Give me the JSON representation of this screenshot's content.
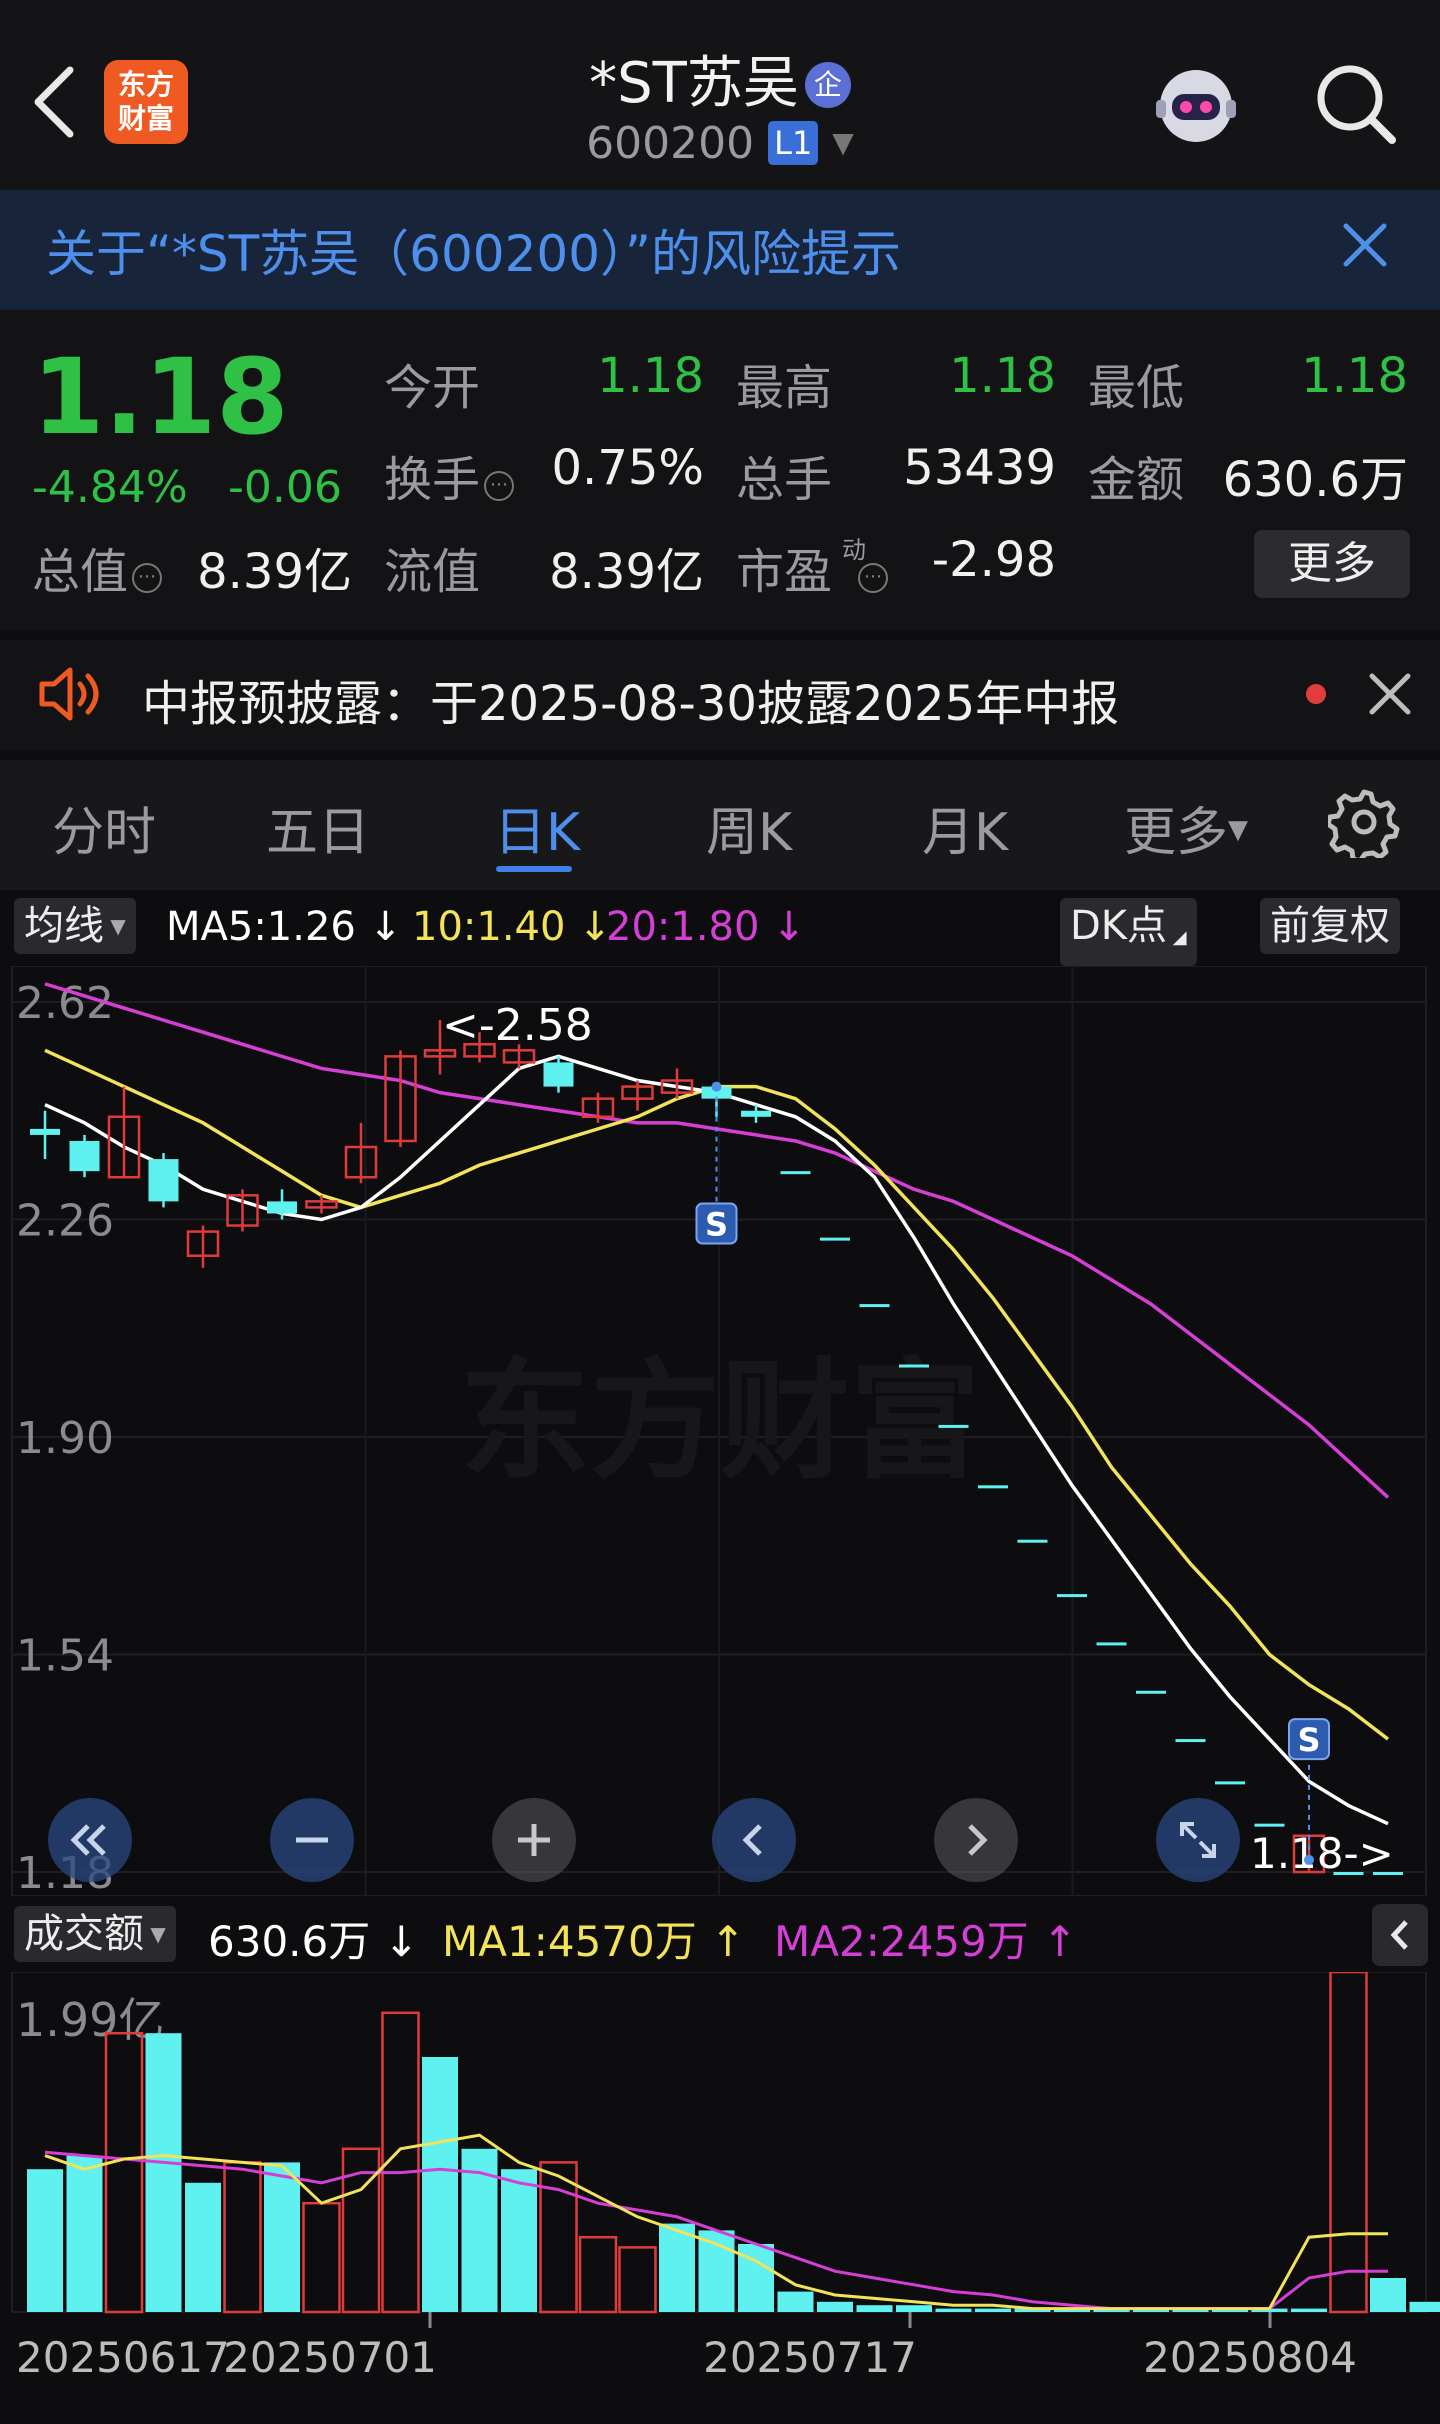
{
  "header": {
    "title": "*ST苏吴",
    "title_badge": "企",
    "code": "600200",
    "level": "L1",
    "logo_text": "东方\n财富"
  },
  "risk_banner": {
    "text": "关于“*ST苏吴（600200）”的风险提示"
  },
  "quote": {
    "price": "1.18",
    "change_pct": "-4.84%",
    "change_abs": "-0.06",
    "open_label": "今开",
    "open": "1.18",
    "high_label": "最高",
    "high": "1.18",
    "low_label": "最低",
    "low": "1.18",
    "turnover_label": "换手",
    "turnover": "0.75%",
    "volume_label": "总手",
    "volume": "53439",
    "amount_label": "金额",
    "amount": "630.6万",
    "mktcap_label": "总值",
    "mktcap": "8.39亿",
    "float_label": "流值",
    "float_cap": "8.39亿",
    "pe_label": "市盈",
    "pe_sup": "动",
    "pe": "-2.98",
    "more_label": "更多",
    "qmark": "⋯"
  },
  "notice": {
    "text": "中报预披露：于2025-08-30披露2025年中报"
  },
  "tabs": [
    {
      "label": "分时"
    },
    {
      "label": "五日"
    },
    {
      "label": "日K"
    },
    {
      "label": "周K"
    },
    {
      "label": "月K"
    },
    {
      "label": "更多"
    }
  ],
  "indicators": {
    "ma_selector": "均线",
    "ma5": "MA5:1.26",
    "ma10": "10:1.40",
    "ma20": "20:1.80",
    "down_arrow": "↓",
    "up_arrow": "↑",
    "dk_label": "DK点",
    "fq_label": "前复权"
  },
  "volume_panel": {
    "selector": "成交额",
    "value": "630.6万",
    "ma1": "MA1:4570万",
    "ma2": "MA2:2459万",
    "y_top_label": "1.99亿"
  },
  "colors": {
    "up": "#e03b3b",
    "down": "#5ff0f0",
    "green": "#2fc146",
    "ma5": "#ffffff",
    "ma10": "#f2e35a",
    "ma20": "#d63fd6",
    "accent": "#3f7fe6"
  },
  "chart_data": {
    "type": "candlestick",
    "y_ticks": [
      "2.62",
      "2.26",
      "1.90",
      "1.54",
      "1.18"
    ],
    "y_range": [
      1.18,
      2.62
    ],
    "high_marker": "<-2.58",
    "last_marker": "1.18->",
    "signal_label": "S",
    "x_tick_labels": [
      "20250617",
      "20250701",
      "20250717",
      "20250804"
    ],
    "candles": [
      {
        "o": 2.41,
        "c": 2.4,
        "h": 2.44,
        "l": 2.36
      },
      {
        "o": 2.39,
        "c": 2.34,
        "h": 2.4,
        "l": 2.33
      },
      {
        "o": 2.33,
        "c": 2.43,
        "h": 2.48,
        "l": 2.33
      },
      {
        "o": 2.36,
        "c": 2.29,
        "h": 2.37,
        "l": 2.28
      },
      {
        "o": 2.2,
        "c": 2.24,
        "h": 2.25,
        "l": 2.18
      },
      {
        "o": 2.25,
        "c": 2.3,
        "h": 2.31,
        "l": 2.24
      },
      {
        "o": 2.29,
        "c": 2.27,
        "h": 2.31,
        "l": 2.26
      },
      {
        "o": 2.28,
        "c": 2.29,
        "h": 2.3,
        "l": 2.27
      },
      {
        "o": 2.33,
        "c": 2.38,
        "h": 2.42,
        "l": 2.32
      },
      {
        "o": 2.39,
        "c": 2.53,
        "h": 2.54,
        "l": 2.38
      },
      {
        "o": 2.53,
        "c": 2.54,
        "h": 2.59,
        "l": 2.5
      },
      {
        "o": 2.53,
        "c": 2.55,
        "h": 2.57,
        "l": 2.52
      },
      {
        "o": 2.52,
        "c": 2.54,
        "h": 2.55,
        "l": 2.51
      },
      {
        "o": 2.52,
        "c": 2.48,
        "h": 2.53,
        "l": 2.47
      },
      {
        "o": 2.43,
        "c": 2.46,
        "h": 2.47,
        "l": 2.42
      },
      {
        "o": 2.46,
        "c": 2.48,
        "h": 2.49,
        "l": 2.44
      },
      {
        "o": 2.47,
        "c": 2.49,
        "h": 2.51,
        "l": 2.46
      },
      {
        "o": 2.48,
        "c": 2.46,
        "h": 2.48,
        "l": 2.43
      },
      {
        "o": 2.44,
        "c": 2.43,
        "h": 2.45,
        "l": 2.42
      },
      {
        "o": 2.34,
        "c": 2.34,
        "h": 2.34,
        "l": 2.34
      },
      {
        "o": 2.23,
        "c": 2.23,
        "h": 2.23,
        "l": 2.23
      },
      {
        "o": 2.12,
        "c": 2.12,
        "h": 2.12,
        "l": 2.12
      },
      {
        "o": 2.02,
        "c": 2.02,
        "h": 2.02,
        "l": 2.02
      },
      {
        "o": 1.92,
        "c": 1.92,
        "h": 1.92,
        "l": 1.92
      },
      {
        "o": 1.82,
        "c": 1.82,
        "h": 1.82,
        "l": 1.82
      },
      {
        "o": 1.73,
        "c": 1.73,
        "h": 1.73,
        "l": 1.73
      },
      {
        "o": 1.64,
        "c": 1.64,
        "h": 1.64,
        "l": 1.64
      },
      {
        "o": 1.56,
        "c": 1.56,
        "h": 1.56,
        "l": 1.56
      },
      {
        "o": 1.48,
        "c": 1.48,
        "h": 1.48,
        "l": 1.48
      },
      {
        "o": 1.4,
        "c": 1.4,
        "h": 1.4,
        "l": 1.4
      },
      {
        "o": 1.33,
        "c": 1.33,
        "h": 1.33,
        "l": 1.33
      },
      {
        "o": 1.26,
        "c": 1.26,
        "h": 1.26,
        "l": 1.26
      },
      {
        "o": 1.18,
        "c": 1.24,
        "h": 1.24,
        "l": 1.18
      },
      {
        "o": 1.18,
        "c": 1.18,
        "h": 1.18,
        "l": 1.18
      },
      {
        "o": 1.18,
        "c": 1.18,
        "h": 1.18,
        "l": 1.18
      }
    ],
    "ma5": [
      2.45,
      2.42,
      2.38,
      2.35,
      2.31,
      2.29,
      2.27,
      2.26,
      2.28,
      2.33,
      2.39,
      2.45,
      2.51,
      2.53,
      2.51,
      2.49,
      2.48,
      2.47,
      2.45,
      2.43,
      2.39,
      2.33,
      2.23,
      2.12,
      2.02,
      1.92,
      1.82,
      1.73,
      1.64,
      1.55,
      1.47,
      1.4,
      1.33,
      1.29,
      1.26
    ],
    "ma10": [
      2.54,
      2.51,
      2.48,
      2.45,
      2.42,
      2.38,
      2.34,
      2.3,
      2.28,
      2.3,
      2.32,
      2.35,
      2.37,
      2.39,
      2.41,
      2.43,
      2.46,
      2.48,
      2.48,
      2.46,
      2.41,
      2.35,
      2.28,
      2.21,
      2.13,
      2.04,
      1.95,
      1.85,
      1.77,
      1.69,
      1.62,
      1.54,
      1.49,
      1.45,
      1.4
    ],
    "ma20": [
      2.65,
      2.63,
      2.61,
      2.59,
      2.57,
      2.55,
      2.53,
      2.51,
      2.5,
      2.49,
      2.47,
      2.46,
      2.45,
      2.44,
      2.43,
      2.42,
      2.42,
      2.41,
      2.4,
      2.39,
      2.37,
      2.34,
      2.31,
      2.29,
      2.26,
      2.23,
      2.2,
      2.16,
      2.12,
      2.07,
      2.02,
      1.97,
      1.92,
      1.86,
      1.8
    ],
    "volume_relative": [
      0.42,
      0.46,
      0.82,
      0.82,
      0.38,
      0.44,
      0.44,
      0.32,
      0.48,
      0.88,
      0.75,
      0.48,
      0.42,
      0.44,
      0.22,
      0.19,
      0.26,
      0.24,
      0.2,
      0.06,
      0.03,
      0.02,
      0.02,
      0.01,
      0.01,
      0.01,
      0.01,
      0.01,
      0.01,
      0.01,
      0.01,
      0.01,
      0.01,
      1.0,
      0.1,
      0.03
    ],
    "volume_up": [
      false,
      false,
      true,
      false,
      false,
      true,
      false,
      true,
      true,
      true,
      false,
      false,
      false,
      true,
      true,
      true,
      false,
      false,
      false,
      false,
      false,
      false,
      false,
      false,
      false,
      false,
      false,
      false,
      false,
      false,
      false,
      false,
      false,
      true,
      false,
      false
    ],
    "vol_ma1_relative": [
      0.46,
      0.42,
      0.45,
      0.46,
      0.45,
      0.44,
      0.43,
      0.32,
      0.36,
      0.48,
      0.5,
      0.52,
      0.44,
      0.4,
      0.34,
      0.28,
      0.24,
      0.2,
      0.15,
      0.08,
      0.05,
      0.04,
      0.03,
      0.02,
      0.02,
      0.01,
      0.01,
      0.01,
      0.01,
      0.01,
      0.01,
      0.01,
      0.22,
      0.23,
      0.23
    ],
    "vol_ma2_relative": [
      0.47,
      0.46,
      0.45,
      0.44,
      0.43,
      0.42,
      0.4,
      0.38,
      0.41,
      0.41,
      0.42,
      0.41,
      0.38,
      0.36,
      0.32,
      0.3,
      0.28,
      0.24,
      0.2,
      0.16,
      0.12,
      0.1,
      0.08,
      0.06,
      0.05,
      0.03,
      0.02,
      0.01,
      0.01,
      0.01,
      0.01,
      0.01,
      0.1,
      0.12,
      0.12
    ]
  }
}
